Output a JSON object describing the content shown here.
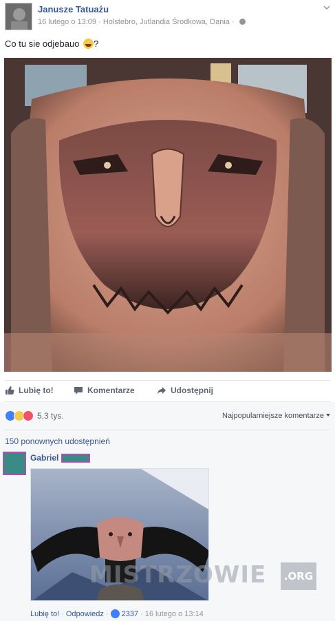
{
  "post": {
    "page_name": "Janusze Tatuażu",
    "date": "16 lutego o 13:09",
    "location": "Holstebro, Jutlandia Środkowa, Dania",
    "separator": "·",
    "text": "Co tu sie odjebauo",
    "text_suffix": "?",
    "photo_icon": "tattoo-photo"
  },
  "actions": {
    "like": "Lubię to!",
    "comment": "Komentarze",
    "share": "Udostępnij"
  },
  "reactions": {
    "icons": [
      "like-icon",
      "haha-icon",
      "love-icon"
    ],
    "count": "5,3 tys.",
    "sort_label": "Najpopularniejsze komentarze"
  },
  "shares": "150 ponownych udostępnień",
  "comment": {
    "author": "Gabriel",
    "like_label": "Lubię to!",
    "reply_label": "Odpowiedz",
    "like_count": "2337",
    "date": "16 lutego o 13:14",
    "separator": "·"
  },
  "watermark": {
    "text": "MISTRZOWIE",
    "suffix": ".ORG"
  },
  "colors": {
    "link": "#365899",
    "meta": "#90949c",
    "reaction_like": "#4080ff",
    "reaction_haha": "#f7c948",
    "reaction_love": "#f25268"
  }
}
